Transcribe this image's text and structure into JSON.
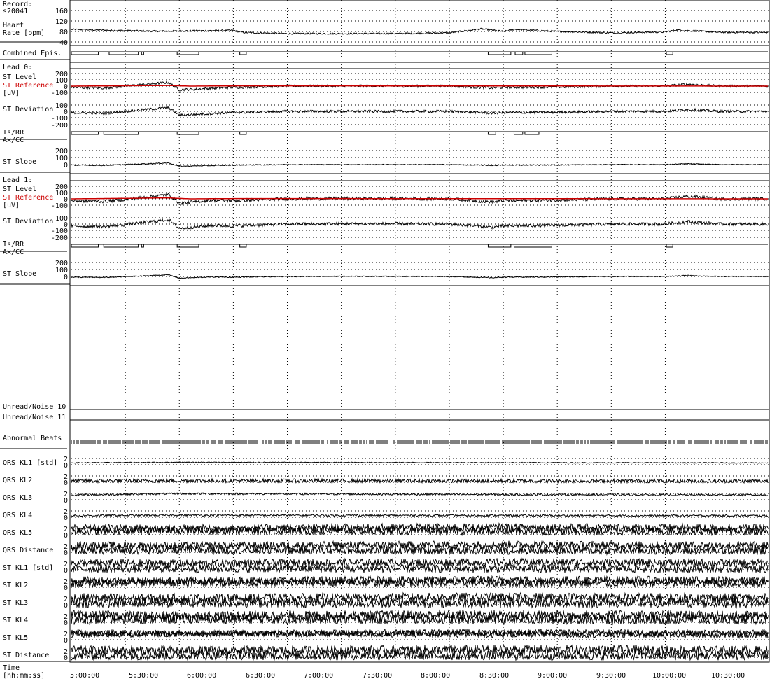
{
  "record": {
    "label": "Record:",
    "id": "s20041"
  },
  "time_axis": {
    "label_line1": "Time",
    "label_line2": "[hh:mm:ss]",
    "ticks": [
      "5:00:00",
      "5:30:00",
      "6:00:00",
      "6:30:00",
      "7:00:00",
      "7:30:00",
      "8:00:00",
      "8:30:00",
      "9:00:00",
      "9:30:00",
      "10:00:00",
      "10:30:00"
    ],
    "range_hours": [
      4.99,
      11.45
    ]
  },
  "labels": {
    "hr_line1": "Heart",
    "hr_line2": "Rate [bpm]",
    "combined": "Combined Epis.",
    "lead0_title": "Lead 0:",
    "lead1_title": "Lead 1:",
    "st_level": "ST Level",
    "st_reference": "ST Reference",
    "uv": "[uV]",
    "st_deviation": "ST Deviation",
    "isrr": "Is/RR",
    "axcc": "Ax/CC",
    "st_slope": "ST Slope",
    "unread10": "Unread/Noise 10",
    "unread11": "Unread/Noise 11",
    "abnormal": "Abnormal Beats",
    "qrs_kl1": "QRS KL1 [std]",
    "qrs_kl2": "QRS KL2",
    "qrs_kl3": "QRS KL3",
    "qrs_kl4": "QRS KL4",
    "qrs_kl5": "QRS KL5",
    "qrs_distance": "QRS Distance",
    "st_kl1": "ST KL1 [std]",
    "st_kl2": "ST KL2",
    "st_kl3": "ST KL3",
    "st_kl4": "ST KL4",
    "st_kl5": "ST KL5",
    "st_distance": "ST Distance"
  },
  "ticklabels": {
    "hr": [
      "160",
      "120",
      "80",
      "40"
    ],
    "st200": [
      "200",
      "100",
      "0",
      "-100"
    ],
    "dev": [
      "100",
      "0",
      "-100",
      "-200"
    ],
    "slope": [
      "200",
      "100",
      "0"
    ],
    "kl": [
      "2",
      "0"
    ]
  },
  "colors": {
    "trace": "#000000",
    "reference": "#cc0000",
    "grid": "#000000",
    "background": "#ffffff"
  },
  "chart_data": {
    "type": "line",
    "x_unit": "hours",
    "series": [
      {
        "name": "Heart Rate [bpm]",
        "x": [
          5.0,
          5.5,
          5.8,
          6.0,
          6.5,
          6.6,
          7.0,
          7.5,
          8.0,
          8.5,
          8.8,
          9.0,
          9.1,
          9.5,
          10.0,
          10.5,
          10.6,
          11.0,
          11.45
        ],
        "y": [
          88,
          83,
          81,
          82,
          84,
          76,
          72,
          72,
          72,
          75,
          90,
          80,
          88,
          80,
          75,
          78,
          86,
          77,
          76
        ]
      },
      {
        "name": "Lead 0 ST Level",
        "x": [
          5.0,
          5.3,
          5.5,
          5.9,
          6.0,
          6.5,
          7.0,
          7.5,
          8.0,
          8.5,
          8.9,
          9.0,
          9.5,
          10.0,
          10.5,
          10.7,
          11.0,
          11.45
        ],
        "y": [
          -20,
          -30,
          0,
          60,
          -60,
          -20,
          0,
          0,
          0,
          0,
          -30,
          -20,
          -15,
          0,
          0,
          30,
          0,
          0
        ]
      },
      {
        "name": "Lead 0 ST Reference",
        "x": [
          5.0,
          5.9,
          6.1,
          6.6,
          11.45
        ],
        "y": [
          0,
          10,
          0,
          5,
          0
        ]
      },
      {
        "name": "Lead 1 ST Level",
        "x": [
          5.0,
          5.3,
          5.5,
          5.9,
          6.0,
          6.3,
          6.5,
          7.0,
          7.5,
          8.0,
          8.5,
          8.9,
          9.0,
          9.5,
          10.0,
          10.5,
          10.7,
          11.0,
          11.45
        ],
        "y": [
          -30,
          -40,
          -10,
          70,
          -70,
          -20,
          -30,
          0,
          5,
          5,
          0,
          -50,
          -30,
          -20,
          0,
          0,
          40,
          0,
          0
        ]
      },
      {
        "name": "Lead 1 ST Reference",
        "x": [
          5.0,
          5.9,
          6.1,
          6.6,
          11.45
        ],
        "y": [
          0,
          15,
          0,
          5,
          0
        ]
      }
    ],
    "episodes": {
      "combined": [
        [
          5.0,
          5.25
        ],
        [
          5.35,
          5.62
        ],
        [
          5.65,
          5.67
        ],
        [
          5.98,
          6.18
        ],
        [
          6.56,
          6.62
        ],
        [
          8.86,
          9.07
        ],
        [
          9.11,
          9.18
        ],
        [
          9.2,
          9.45
        ],
        [
          10.51,
          10.57
        ]
      ],
      "lead0": [
        [
          5.0,
          5.25
        ],
        [
          5.3,
          5.62
        ],
        [
          5.98,
          6.18
        ],
        [
          6.56,
          6.62
        ],
        [
          8.86,
          8.93
        ],
        [
          9.1,
          9.18
        ],
        [
          9.2,
          9.33
        ]
      ],
      "lead1": [
        [
          5.0,
          5.25
        ],
        [
          5.3,
          5.62
        ],
        [
          5.65,
          5.67
        ],
        [
          5.98,
          6.18
        ],
        [
          6.56,
          6.62
        ],
        [
          8.86,
          9.07
        ],
        [
          9.1,
          9.45
        ],
        [
          10.51,
          10.57
        ]
      ]
    }
  }
}
